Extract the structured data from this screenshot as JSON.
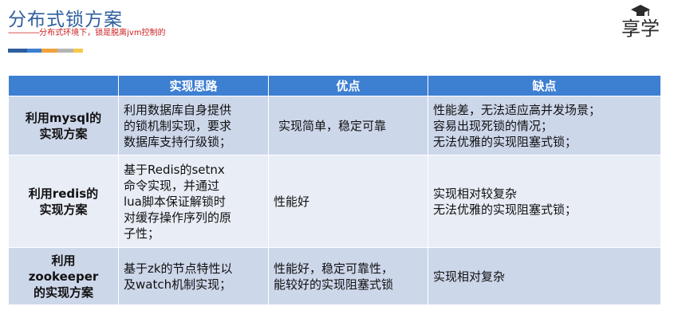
{
  "header": {
    "title": "分布式锁方案",
    "subtitle_dashes": "---------------",
    "subtitle": "分布式环境下，锁是脱离jvm控制的",
    "logo_text": "享学"
  },
  "colors": {
    "title": "#2e5e9e",
    "subtitle": "#cc1f1f",
    "table_header": "#3d7fd1",
    "row_dark": "#cdd7ea",
    "row_light": "#e8edf6",
    "bar": [
      "#2e5e9e",
      "#3d7fd1",
      "#f0a23a",
      "#b5b5b5",
      "#f7c948"
    ]
  },
  "table": {
    "headers": [
      "",
      "实现思路",
      "优点",
      "缺点"
    ],
    "rows": [
      {
        "name": [
          "利用mysql的",
          "实现方案"
        ],
        "approach": [
          "利用数据库自身提供",
          "的锁机制实现，要求",
          "数据库支持行级锁；"
        ],
        "pros": [
          "实现简单，稳定可靠"
        ],
        "cons": [
          "性能差，无法适应高并发场景；",
          "容易出现死锁的情况；",
          "无法优雅的实现阻塞式锁；"
        ]
      },
      {
        "name": [
          "利用redis的",
          "实现方案"
        ],
        "approach": [
          "基于Redis的setnx",
          "命令实现，并通过",
          "lua脚本保证解锁时",
          "对缓存操作序列的原",
          "子性；"
        ],
        "pros": [
          "性能好"
        ],
        "cons": [
          "实现相对较复杂",
          "无法优雅的实现阻塞式锁；"
        ]
      },
      {
        "name": [
          "利用",
          "zookeeper",
          "的实现方案"
        ],
        "approach": [
          "基于zk的节点特性以",
          "及watch机制实现；"
        ],
        "pros": [
          "性能好，稳定可靠性，",
          "能较好的实现阻塞式锁"
        ],
        "cons": [
          "实现相对复杂"
        ]
      }
    ]
  }
}
